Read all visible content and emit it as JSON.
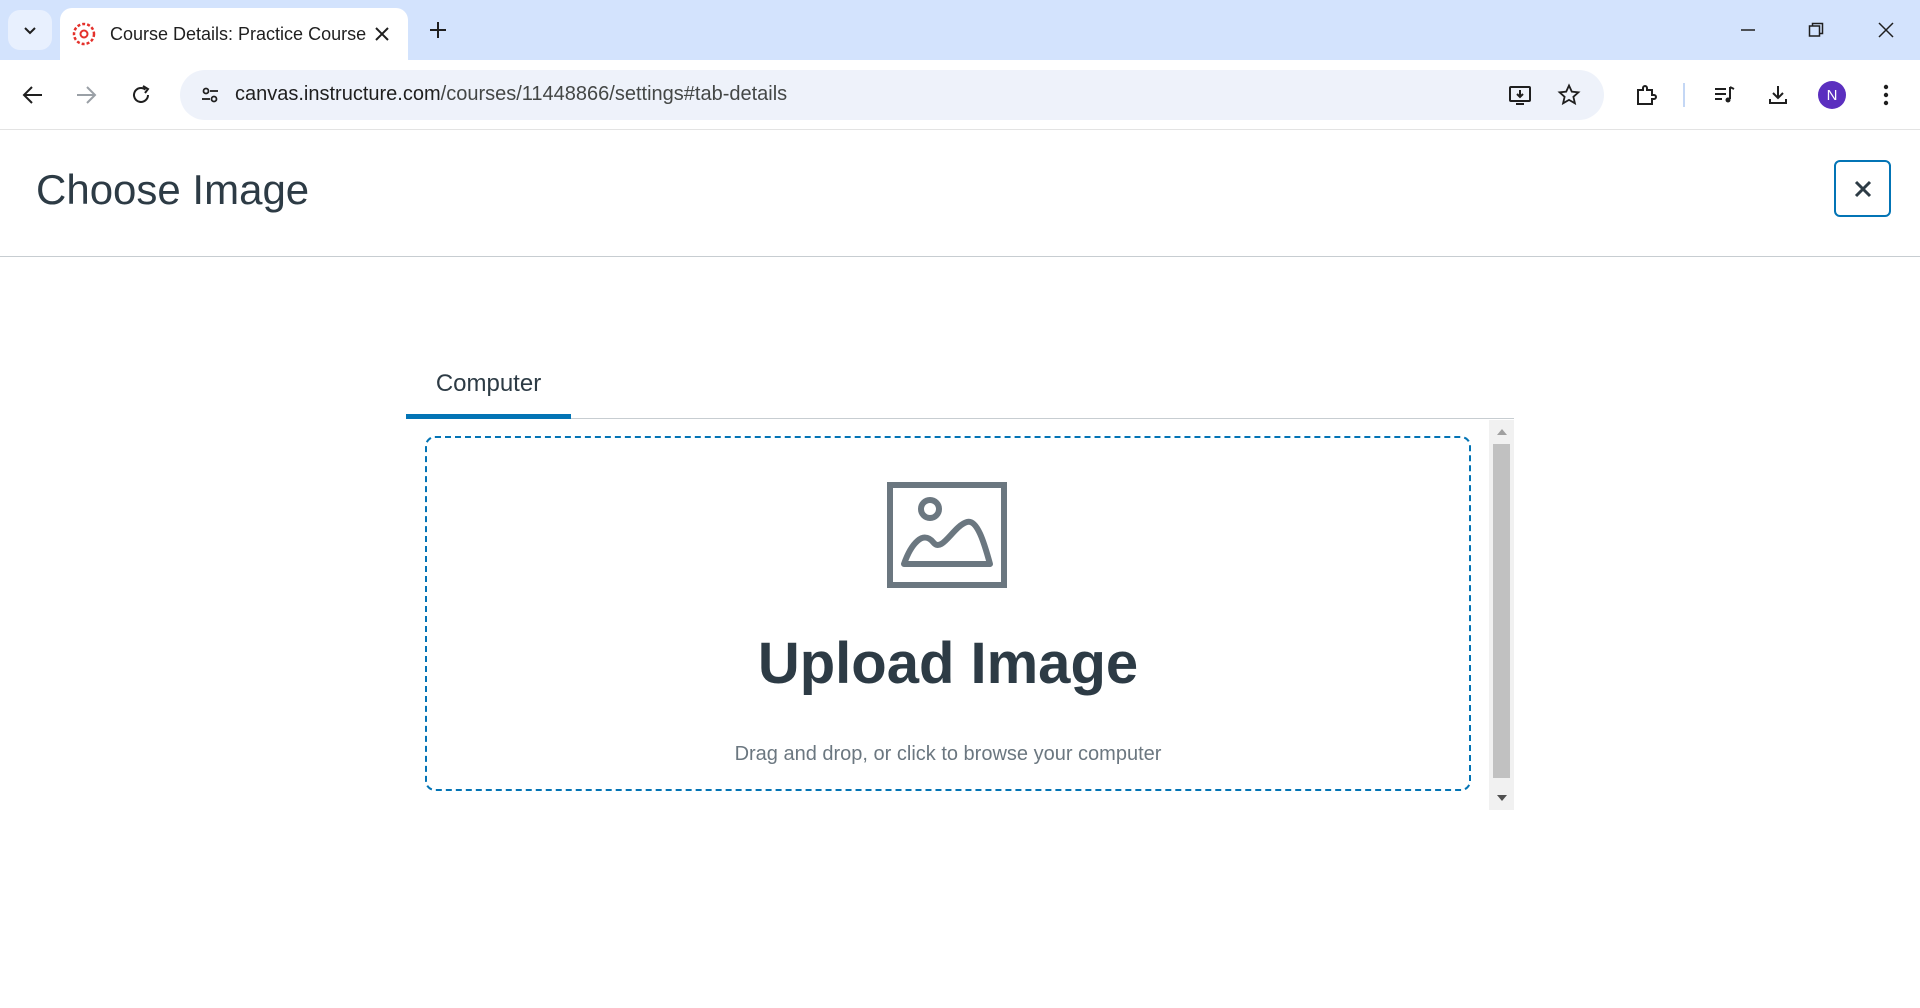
{
  "browser": {
    "tab_title": "Course Details: Practice Course",
    "url_host": "canvas.instructure.com",
    "url_path": "/courses/11448866/settings#tab-details",
    "avatar_initial": "N",
    "accent_color": "#0374b5"
  },
  "modal": {
    "title": "Choose Image",
    "close_label": "Close"
  },
  "tabs": [
    {
      "label": "Computer",
      "selected": true
    }
  ],
  "upload": {
    "title": "Upload Image",
    "subtitle": "Drag and drop, or click to browse your computer",
    "icon": "image-icon"
  }
}
